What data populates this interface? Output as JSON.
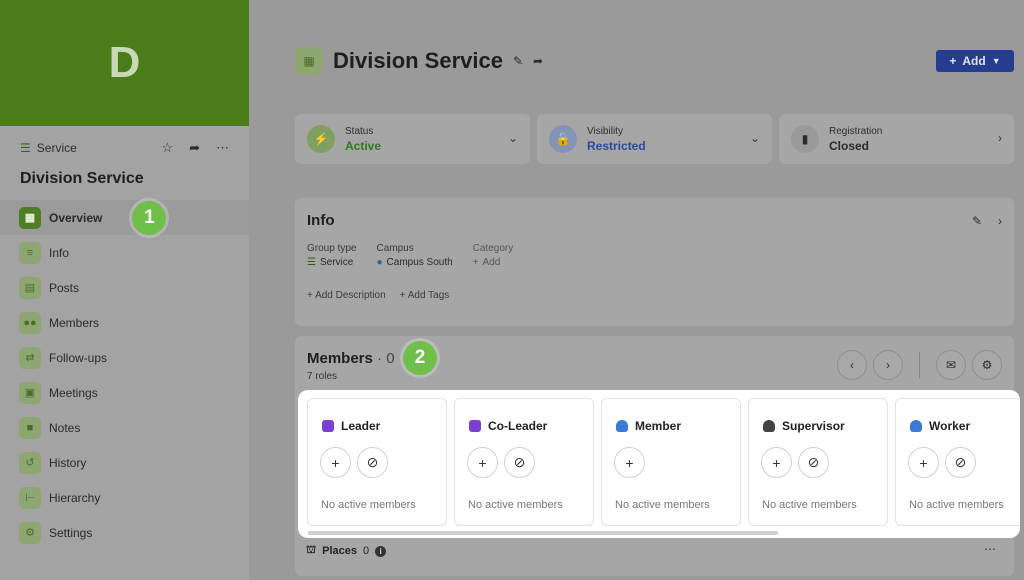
{
  "sidebar": {
    "banner_letter": "D",
    "group_type": "Service",
    "title": "Division Service",
    "step_badge": "1",
    "items": [
      {
        "label": "Overview",
        "icon": "grid-icon",
        "active": true
      },
      {
        "label": "Info",
        "icon": "list-icon"
      },
      {
        "label": "Posts",
        "icon": "posts-icon"
      },
      {
        "label": "Members",
        "icon": "people-icon"
      },
      {
        "label": "Follow-ups",
        "icon": "handshake-icon"
      },
      {
        "label": "Meetings",
        "icon": "calendar-icon"
      },
      {
        "label": "Notes",
        "icon": "note-icon"
      },
      {
        "label": "History",
        "icon": "history-icon"
      },
      {
        "label": "Hierarchy",
        "icon": "hierarchy-icon"
      },
      {
        "label": "Settings",
        "icon": "gear-icon"
      }
    ]
  },
  "header": {
    "title": "Division Service",
    "add_label": "Add"
  },
  "status_cards": [
    {
      "label": "Status",
      "value": "Active",
      "color": "#2f7a1e"
    },
    {
      "label": "Visibility",
      "value": "Restricted",
      "color": "#2a4a9a"
    },
    {
      "label": "Registration",
      "value": "Closed",
      "color": "#2b2b2b"
    }
  ],
  "info": {
    "title": "Info",
    "fields": [
      {
        "label": "Group type",
        "value": "Service"
      },
      {
        "label": "Campus",
        "value": "Campus South"
      },
      {
        "label": "Category",
        "value": "Add"
      }
    ],
    "add_description": "Add Description",
    "add_tags": "Add Tags"
  },
  "members": {
    "title": "Members",
    "count": "· 0",
    "roles_count": "7 roles",
    "step_badge": "2",
    "roles": [
      {
        "name": "Leader",
        "empty": "No active members",
        "icon_color": "#7b3fd1",
        "has_block": true
      },
      {
        "name": "Co-Leader",
        "empty": "No active members",
        "icon_color": "#7b3fd1",
        "has_block": true
      },
      {
        "name": "Member",
        "empty": "No active members",
        "icon_color": "#3a7bd5",
        "has_block": false
      },
      {
        "name": "Supervisor",
        "empty": "No active members",
        "icon_color": "#444444",
        "has_block": true
      },
      {
        "name": "Worker",
        "empty": "No active members",
        "icon_color": "#3a7bd5",
        "has_block": true
      }
    ]
  },
  "places": {
    "label": "Places",
    "count": "0"
  }
}
